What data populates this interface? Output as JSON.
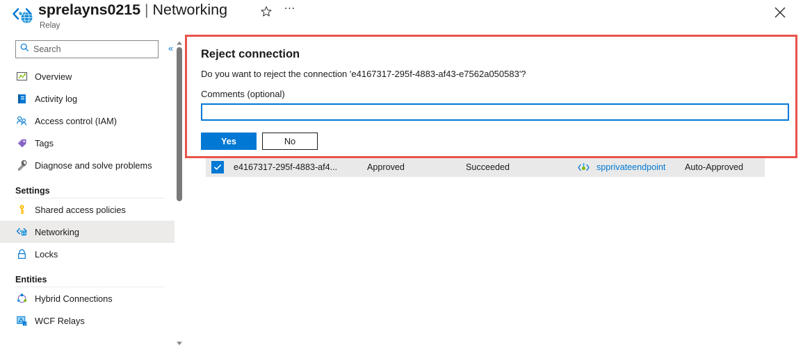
{
  "header": {
    "resource_icon": "relay-icon",
    "resource_name": "sprelayns0215",
    "separator": "|",
    "page_name": "Networking",
    "resource_type": "Relay",
    "favorite_icon": "star-icon",
    "more_icon": "ellipsis-icon",
    "close_icon": "close-icon"
  },
  "sidebar": {
    "search": {
      "placeholder": "Search",
      "value": "",
      "icon": "search-icon"
    },
    "collapse_icon": "chevron-double-left-icon",
    "items": [
      {
        "label": "Overview",
        "icon": "overview-icon",
        "selected": false
      },
      {
        "label": "Activity log",
        "icon": "activity-log-icon",
        "selected": false
      },
      {
        "label": "Access control (IAM)",
        "icon": "access-control-icon",
        "selected": false
      },
      {
        "label": "Tags",
        "icon": "tags-icon",
        "selected": false
      },
      {
        "label": "Diagnose and solve problems",
        "icon": "diagnose-icon",
        "selected": false
      }
    ],
    "groups": [
      {
        "title": "Settings",
        "items": [
          {
            "label": "Shared access policies",
            "icon": "key-icon",
            "selected": false
          },
          {
            "label": "Networking",
            "icon": "networking-icon",
            "selected": true
          },
          {
            "label": "Locks",
            "icon": "lock-icon",
            "selected": false
          }
        ]
      },
      {
        "title": "Entities",
        "items": [
          {
            "label": "Hybrid Connections",
            "icon": "hybrid-connections-icon",
            "selected": false
          },
          {
            "label": "WCF Relays",
            "icon": "wcf-relays-icon",
            "selected": false
          }
        ]
      }
    ]
  },
  "dialog": {
    "title": "Reject connection",
    "question": "Do you want to reject the connection 'e4167317-295f-4883-af43-e7562a050583'?",
    "comments_label": "Comments (optional)",
    "comments_value": "",
    "comments_placeholder": "",
    "confirm_label": "Yes",
    "cancel_label": "No",
    "highlight_color": "#e8534b",
    "accent_color": "#0078d4"
  },
  "connections_table": {
    "rows": [
      {
        "checked": true,
        "name": "e4167317-295f-4883-af4...",
        "connection_state": "Approved",
        "provisioning_state": "Succeeded",
        "private_endpoint": "spprivateendpoint",
        "private_endpoint_icon": "private-endpoint-icon",
        "description": "Auto-Approved"
      }
    ]
  }
}
